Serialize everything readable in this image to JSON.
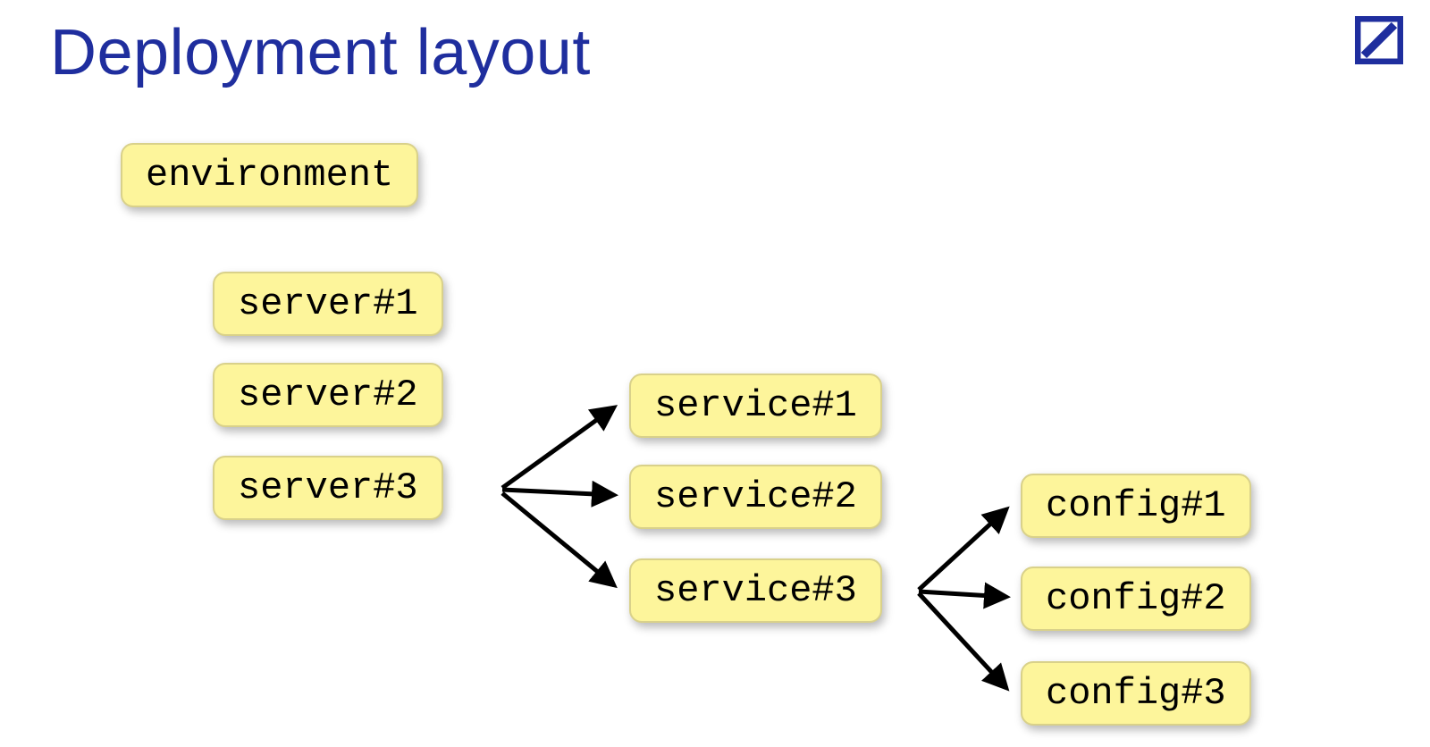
{
  "title": "Deployment layout",
  "nodes": {
    "environment": "environment",
    "server1": "server#1",
    "server2": "server#2",
    "server3": "server#3",
    "service1": "service#1",
    "service2": "service#2",
    "service3": "service#3",
    "config1": "config#1",
    "config2": "config#2",
    "config3": "config#3"
  }
}
